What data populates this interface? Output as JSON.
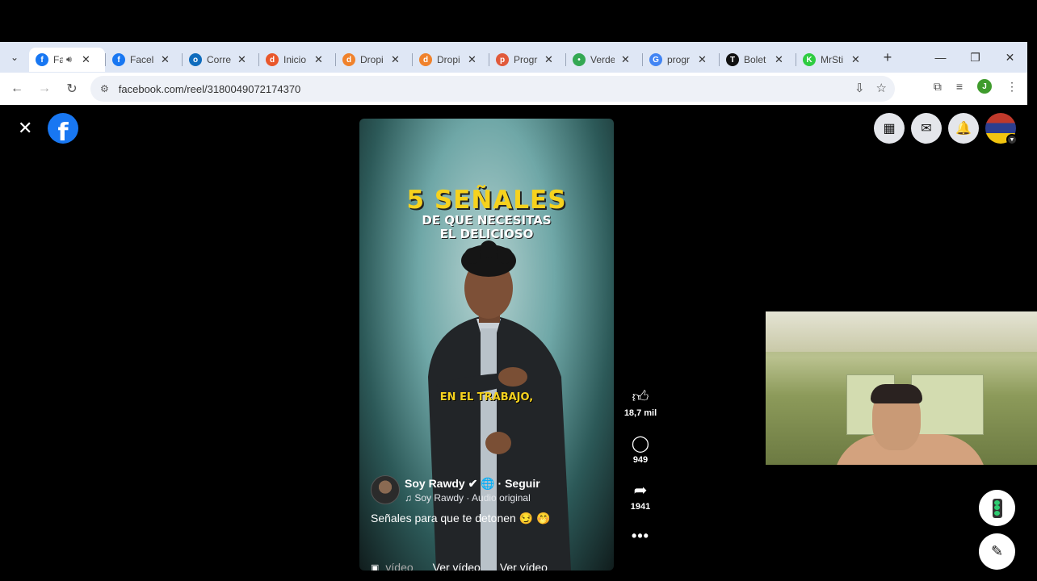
{
  "browser": {
    "tabs": [
      {
        "title": "Fa",
        "favicon": "facebook-icon",
        "color": "#1877f2",
        "glyph": "f",
        "active": true,
        "sound": true
      },
      {
        "title": "Facel",
        "favicon": "facebook-icon",
        "color": "#1877f2",
        "glyph": "f"
      },
      {
        "title": "Corre",
        "favicon": "outlook-icon",
        "color": "#0f6cbd",
        "glyph": "o"
      },
      {
        "title": "Inicio",
        "favicon": "dropi-icon",
        "color": "#e9572b",
        "glyph": "d"
      },
      {
        "title": "Dropi",
        "favicon": "dropi-icon",
        "color": "#f0822c",
        "glyph": "d"
      },
      {
        "title": "Dropi",
        "favicon": "dropi-icon",
        "color": "#f0822c",
        "glyph": "d"
      },
      {
        "title": "Progr",
        "favicon": "progress-icon",
        "color": "#e15a3b",
        "glyph": "p"
      },
      {
        "title": "Verde",
        "favicon": "maps-pin-icon",
        "color": "#34a853",
        "glyph": "•"
      },
      {
        "title": "progr",
        "favicon": "google-icon",
        "color": "#4285f4",
        "glyph": "G"
      },
      {
        "title": "Bolet",
        "favicon": "t-logo-icon",
        "color": "#111111",
        "glyph": "T"
      },
      {
        "title": "MrSti",
        "favicon": "k-logo-icon",
        "color": "#2ecc40",
        "glyph": "K"
      }
    ],
    "url": "facebook.com/reel/3180049072174370",
    "profile_initial": "J"
  },
  "reel": {
    "headline": "5 SEÑALES",
    "subheadline_1": "DE QUE NECESITAS",
    "subheadline_2": "EL DELICIOSO",
    "subtitle": "EN EL TRABAJO,",
    "author_name": "Soy Rawdy",
    "author_meta": "· Seguir",
    "audio": "Soy Rawdy · Audio original",
    "caption": "Señales para que te detonen 😏 🤭",
    "bottom_link_1": "vídeo",
    "bottom_link_2": "Ver vídeo",
    "bottom_link_3": "Ver vídeo",
    "progress": 0.6
  },
  "actions": {
    "likes": "18,7 mil",
    "comments": "949",
    "shares": "1941"
  }
}
